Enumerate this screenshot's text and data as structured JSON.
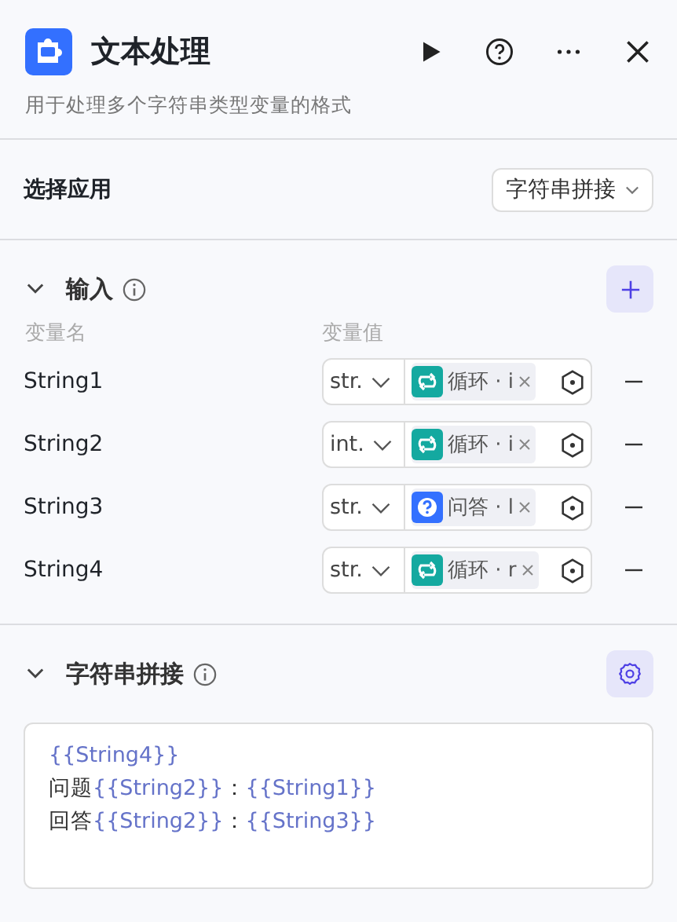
{
  "header": {
    "title": "文本处理",
    "description": "用于处理多个字符串类型变量的格式"
  },
  "app_select": {
    "label": "选择应用",
    "value": "字符串拼接"
  },
  "input": {
    "title": "输入",
    "expanded": true,
    "columns": [
      "变量名",
      "变量值"
    ],
    "rows": [
      {
        "name": "String1",
        "type": "str.",
        "kind": "loop",
        "source": "循环 · i"
      },
      {
        "name": "String2",
        "type": "int.",
        "kind": "loop",
        "source": "循环 · i"
      },
      {
        "name": "String3",
        "type": "str.",
        "kind": "qa",
        "source": "问答 · l"
      },
      {
        "name": "String4",
        "type": "str.",
        "kind": "loop",
        "source": "循环 · r"
      }
    ]
  },
  "concat": {
    "title": "字符串拼接",
    "expanded": true,
    "lines": [
      [
        {
          "kind": "var",
          "text": "{{String4}}"
        }
      ],
      [
        {
          "kind": "text",
          "text": "问题"
        },
        {
          "kind": "var",
          "text": "{{String2}}"
        },
        {
          "kind": "text",
          "text": "："
        },
        {
          "kind": "var",
          "text": "{{String1}}"
        }
      ],
      [
        {
          "kind": "text",
          "text": "回答"
        },
        {
          "kind": "var",
          "text": "{{String2}}"
        },
        {
          "kind": "text",
          "text": "："
        },
        {
          "kind": "var",
          "text": "{{String3}}"
        }
      ]
    ]
  }
}
